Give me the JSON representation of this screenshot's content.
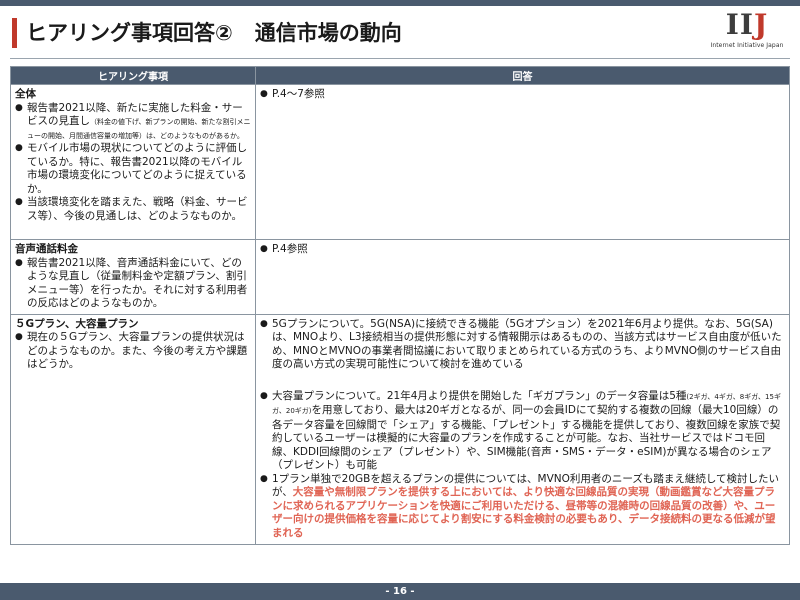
{
  "header": {
    "title": "ヒアリング事項回答②",
    "subtitle": "通信市場の動向",
    "logo_text": "IIJ",
    "logo_tagline": "Internet Initiative Japan",
    "accent_color": "#c0392b",
    "bar_color": "#4a5a6e"
  },
  "table": {
    "col_question": "ヒアリング事項",
    "col_answer": "回答",
    "rows": [
      {
        "section": "全体",
        "q1_main": "報告書2021以降、新たに実施した料金・サービスの見直し",
        "q1_note": "（料金の値下げ、新プランの開始、新たな割引メニューの開始、月間通信容量の増加等）は、どのようなものがあるか。",
        "q2": "モバイル市場の現状についてどのように評価しているか。特に、報告書2021以降のモバイル市場の環境変化についてどのように捉えているか。",
        "q3": "当該環境変化を踏まえた、戦略（料金、サービス等）、今後の見通しは、どのようなものか。",
        "a1": "P.4〜7参照"
      },
      {
        "section": "音声通話料金",
        "q1": "報告書2021以降、音声通話料金にいて、どのような見直し（従量制料金や定額プラン、割引メニュー等）を行ったか。それに対する利用者の反応はどのようなものか。",
        "a1": "P.4参照"
      },
      {
        "section": "５Gプラン、大容量プラン",
        "q1": "現在の５Gプラン、大容量プランの提供状況はどのようなものか。また、今後の考え方や課題はどうか。",
        "a1": "5Gプランについて。5G(NSA)に接続できる機能（5Gオプション）を2021年6月より提供。なお、5G(SA)は、MNOより、L3接続相当の提供形態に対する情報開示はあるものの、当該方式はサービス自由度が低いため、MNOとMVNOの事業者間協議において取りまとめられている方式のうち、よりMVNO側のサービス自由度の高い方式の実現可能性について検討を進めている",
        "a2_start": "大容量プランについて。21年4月より提供を開始した「ギガプラン」のデータ容量は5種",
        "a2_note": "(2ギガ、4ギガ、8ギガ、15ギガ、20ギガ)",
        "a2_rest": "を用意しており、最大は20ギガとなるが、同一の会員IDにて契約する複数の回線（最大10回線）の各データ容量を回線間で「シェア」する機能、「プレゼント」する機能を提供しており、複数回線を家族で契約しているユーザーは模擬的に大容量のプランを作成することが可能。なお、当社サービスではドコモ回線、KDDI回線間のシェア（プレゼント）や、SIM機能(音声・SMS・データ・eSIM)が異なる場合のシェア（プレゼント）も可能",
        "a3_start": "1プラン単独で20GBを超えるプランの提供については、MVNO利用者のニーズも踏まえ継続して検討したいが、",
        "a3_highlight": "大容量や無制限プランを提供する上においては、より快適な回線品質の実現（動画鑑賞など大容量プランに求められるアプリケーションを快適にご利用いただける、昼帯等の混雑時の回線品質の改善）や、ユーザー向けの提供価格を容量に応じてより割安にする料金検討の必要もあり、データ接続料の更なる低減が望まれる"
      }
    ]
  },
  "footer": {
    "page": "- 16 -"
  }
}
